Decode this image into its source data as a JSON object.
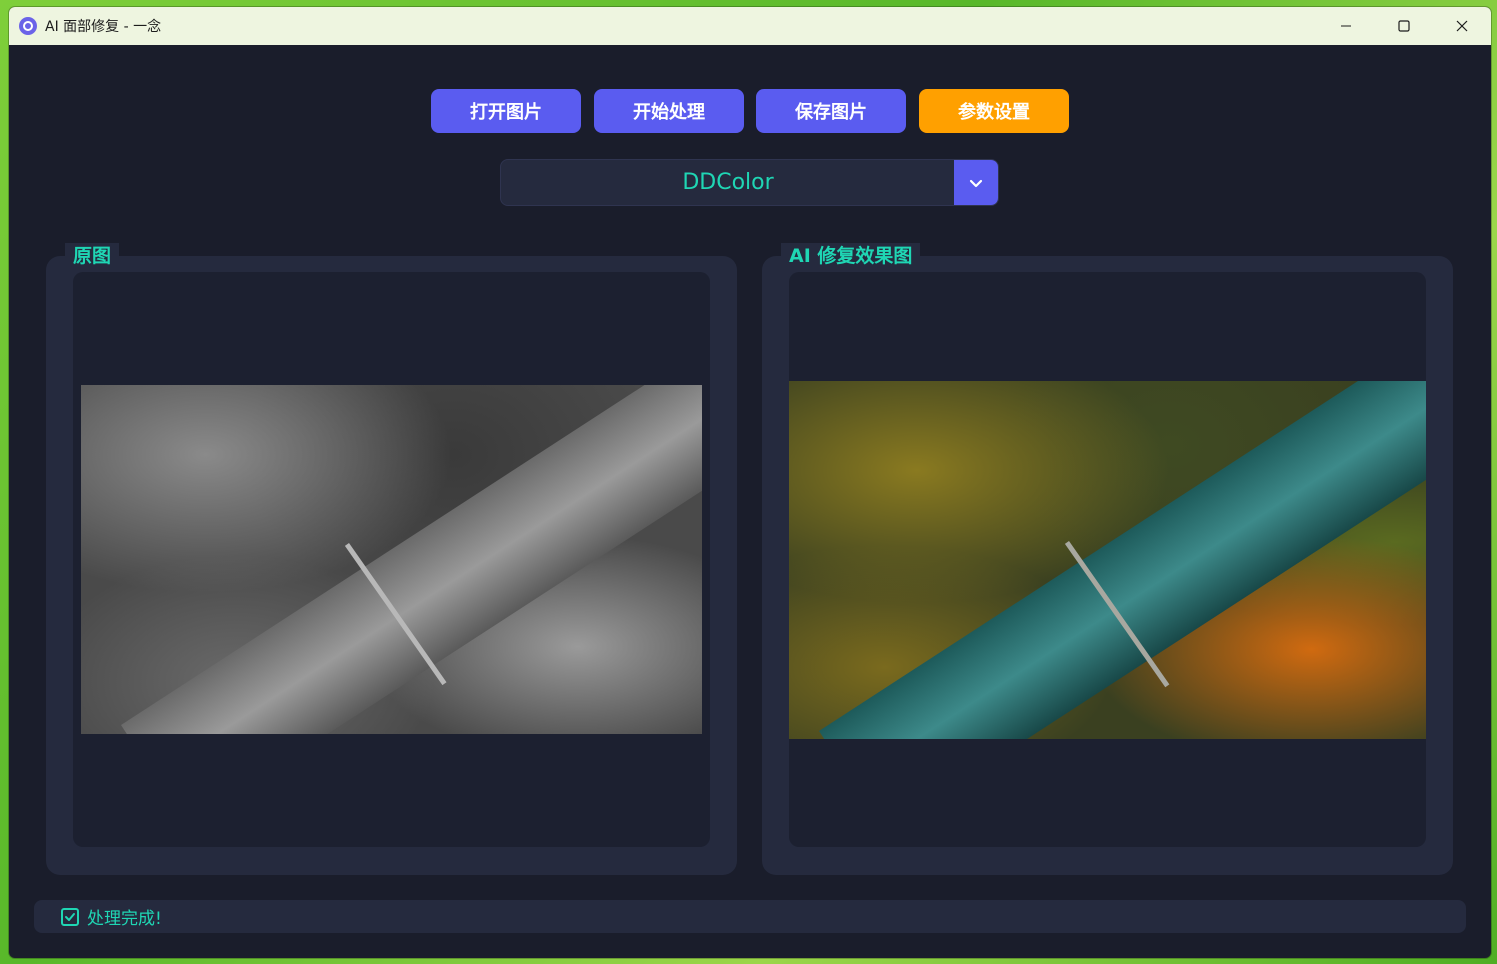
{
  "window": {
    "title": "AI 面部修复 - 一念",
    "icon": "app-logo-icon",
    "controls": [
      "minimize-icon",
      "maximize-icon",
      "close-icon"
    ]
  },
  "toolbar": {
    "open_label": "打开图片",
    "process_label": "开始处理",
    "save_label": "保存图片",
    "settings_label": "参数设置"
  },
  "model_select": {
    "value": "DDColor",
    "icon": "chevron-down-icon"
  },
  "panels": {
    "original_title": "原图",
    "result_title": "AI 修复效果图"
  },
  "status": {
    "icon": "checkbox-check-icon",
    "text": "处理完成!"
  },
  "colors": {
    "accent": "#5a5cf0",
    "highlight": "#ffa000",
    "text_accent": "#1fd6b4",
    "background": "#1a1d2b",
    "panel": "#252a3e"
  }
}
